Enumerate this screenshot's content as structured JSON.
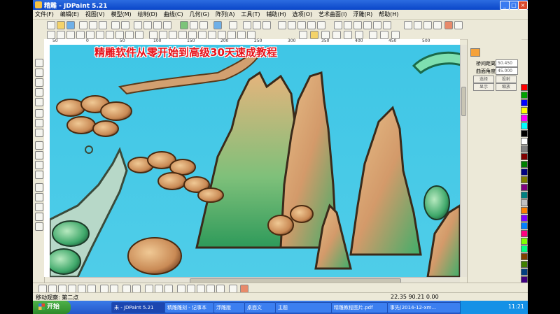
{
  "window": {
    "title": "精雕 - JDPaint 5.21",
    "min": "_",
    "max": "□",
    "close": "×"
  },
  "menu": [
    "文件(F)",
    "编辑(E)",
    "视图(V)",
    "模型(M)",
    "绘制(D)",
    "曲线(C)",
    "几何(G)",
    "阵列(A)",
    "工具(T)",
    "辅助(H)",
    "选项(O)",
    "艺术曲面(I)",
    "浮雕(R)",
    "帮助(H)"
  ],
  "overlay_title": "精雕软件从零开始到高级30天速成教程",
  "ruler": {
    "labels": [
      "50",
      "0",
      "50",
      "100",
      "150",
      "200",
      "250",
      "300",
      "350",
      "400",
      "450",
      "500"
    ]
  },
  "right_panel": {
    "fields": [
      {
        "label": "桥间距离",
        "value": "50.450"
      },
      {
        "label": "曲面角度",
        "value": "45.000"
      }
    ],
    "buttons": [
      "选择",
      "投射",
      "显示",
      "缩放"
    ]
  },
  "palette": [
    "#ff0000",
    "#00a000",
    "#0000ff",
    "#ffff00",
    "#ff00ff",
    "#00ffff",
    "#000000",
    "#ffffff",
    "#808080",
    "#800000",
    "#008000",
    "#000080",
    "#808000",
    "#800080",
    "#008080",
    "#c0c0c0",
    "#ff8000",
    "#8000ff",
    "#0080ff",
    "#ff0080",
    "#80ff00",
    "#00ff80",
    "#804000",
    "#408000",
    "#004080",
    "#400080",
    "#800040",
    "#ffc0c0",
    "#c0ffc0",
    "#c0c0ff"
  ],
  "status": {
    "text": "移动观察: 第二点",
    "coords": "22.35 90.21 0.00"
  },
  "taskbar": {
    "start": "开始",
    "tasks": [
      "未 - JDPaint 5.21",
      "精雕雕刻 - 记事本",
      "浮雕版",
      "桌面文",
      "主题",
      "精雕教程图片.pdf",
      "事先(2014-12-xm..."
    ],
    "clock": "11:21"
  },
  "colors": {
    "canvas": "#46c8e8",
    "title_red": "#e8131b",
    "taskbar": "#2457c9"
  }
}
